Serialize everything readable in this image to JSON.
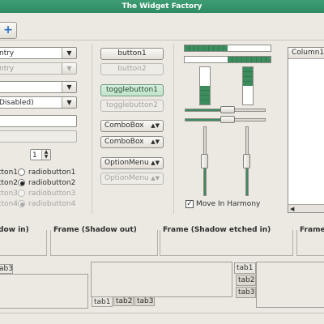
{
  "window": {
    "title": "The Widget Factory"
  },
  "toolbar": {
    "add_icon": "plus-icon",
    "add_glyph": "+"
  },
  "col1": {
    "combo_entry_1": "ntry",
    "combo_entry_2": "ntry",
    "combo_disabled": "Disabled)",
    "spin_value": "1",
    "radios_a": [
      {
        "label": "tton1",
        "checked": false,
        "disabled": false
      },
      {
        "label": "tton2",
        "checked": true,
        "disabled": false
      },
      {
        "label": "tton3",
        "checked": false,
        "disabled": true
      },
      {
        "label": "tton4",
        "checked": true,
        "disabled": true
      }
    ],
    "radios_b": [
      {
        "label": "radiobutton1",
        "checked": false,
        "disabled": false
      },
      {
        "label": "radiobutton2",
        "checked": true,
        "disabled": false
      },
      {
        "label": "radiobutton3",
        "checked": false,
        "disabled": true
      },
      {
        "label": "radiobutton4",
        "checked": true,
        "disabled": true
      }
    ]
  },
  "col2": {
    "button1": "button1",
    "button2": "button2",
    "togglebutton1": "togglebutton1",
    "togglebutton2": "togglebutton2",
    "combobox1": "ComboBox",
    "combobox2": "ComboBox",
    "optionmenu1": "OptionMenu",
    "optionmenu2": "OptionMenu"
  },
  "col3": {
    "progress_h1": 0.5,
    "progress_h2": 0.5,
    "progress_v1": 0.5,
    "progress_v2": 0.5,
    "checkbox_label": "Move In Harmony",
    "checkbox_checked": true
  },
  "col4": {
    "column_header": "Column1"
  },
  "frames": [
    {
      "label": "dow in)"
    },
    {
      "label": "Frame (Shadow out)"
    },
    {
      "label": "Frame (Shadow etched in)"
    },
    {
      "label": "Frame"
    }
  ],
  "notebooks": {
    "left_tab": "ab3",
    "bottom_tabs": [
      "tab1",
      "tab2",
      "tab3"
    ],
    "right_tabs": [
      "tab1",
      "tab2",
      "tab3"
    ]
  },
  "colors": {
    "accent": "#3f9d74",
    "window_bg": "#ece9e2"
  }
}
